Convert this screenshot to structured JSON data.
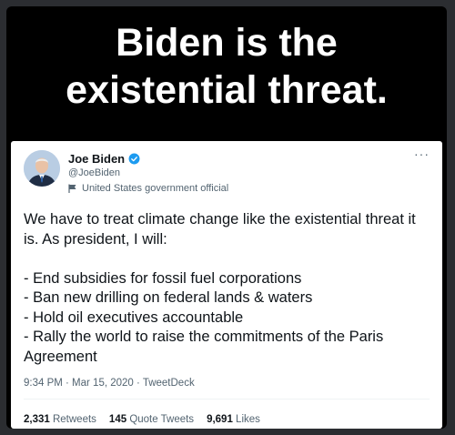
{
  "headline": {
    "line1": "Biden is the",
    "line2": "existential threat."
  },
  "tweet": {
    "author_name": "Joe Biden",
    "handle": "@JoeBiden",
    "label": "United States government official",
    "more": "···",
    "body": {
      "intro": "We have to treat climate change like the existential threat it is. As president, I will:",
      "bullets": [
        "- End subsidies for fossil fuel corporations",
        "- Ban new drilling on federal lands & waters",
        "- Hold oil executives accountable",
        "- Rally the world to raise the commitments of the Paris Agreement"
      ]
    },
    "meta": "9:34 PM · Mar 15, 2020 · TweetDeck",
    "stats": {
      "retweets_count": "2,331",
      "retweets_label": "Retweets",
      "quotes_count": "145",
      "quotes_label": "Quote Tweets",
      "likes_count": "9,691",
      "likes_label": "Likes"
    },
    "colors": {
      "verified": "#1d9bf0",
      "muted": "#536471",
      "text": "#0f1419"
    }
  }
}
